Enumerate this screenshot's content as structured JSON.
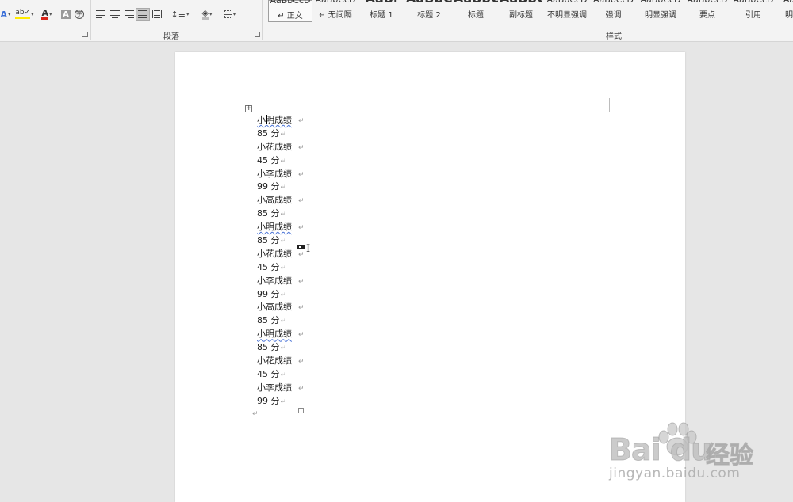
{
  "ribbon": {
    "font_group_buttons": [
      "A",
      "ab✓",
      "A",
      "A",
      "字"
    ],
    "paragraph_label": "段落",
    "styles_label": "样式",
    "styles": [
      {
        "preview": "AaBbCcD",
        "name": "↵ 正文"
      },
      {
        "preview": "AaBbCcD",
        "name": "↵ 无间隔"
      },
      {
        "preview": "AaBl",
        "name": "标题 1"
      },
      {
        "preview": "AaBbC",
        "name": "标题 2"
      },
      {
        "preview": "AaBbC",
        "name": "标题"
      },
      {
        "preview": "AaBbC",
        "name": "副标题"
      },
      {
        "preview": "AaBbCcD",
        "name": "不明显强调"
      },
      {
        "preview": "AaBbCcD",
        "name": "强调"
      },
      {
        "preview": "AaBbCcD",
        "name": "明显强调"
      },
      {
        "preview": "AaBbCcD",
        "name": "要点"
      },
      {
        "preview": "AaBbCcD",
        "name": "引用"
      },
      {
        "preview": "Aa",
        "name": "明"
      }
    ]
  },
  "document": {
    "lines": [
      {
        "text": "小明成绩",
        "kind": "name",
        "mark": "↵"
      },
      {
        "text": "85 分",
        "kind": "score",
        "mark": "↵"
      },
      {
        "text": "小花成绩",
        "kind": "name",
        "mark": "↵"
      },
      {
        "text": "45 分",
        "kind": "score",
        "mark": "↵"
      },
      {
        "text": "小李成绩",
        "kind": "name",
        "mark": "↵"
      },
      {
        "text": "99 分",
        "kind": "score",
        "mark": "↵"
      },
      {
        "text": "小高成绩",
        "kind": "name",
        "mark": "↵"
      },
      {
        "text": "85 分",
        "kind": "score",
        "mark": "↵"
      },
      {
        "text": "小明成绩",
        "kind": "name",
        "mark": "↵"
      },
      {
        "text": "85 分",
        "kind": "score",
        "mark": "↵"
      },
      {
        "text": "小花成绩",
        "kind": "name",
        "mark": "↵"
      },
      {
        "text": "45 分",
        "kind": "score",
        "mark": "↵"
      },
      {
        "text": "小李成绩",
        "kind": "name",
        "mark": "↵"
      },
      {
        "text": "99 分",
        "kind": "score",
        "mark": "↵"
      },
      {
        "text": "小高成绩",
        "kind": "name",
        "mark": "↵"
      },
      {
        "text": "85 分",
        "kind": "score",
        "mark": "↵"
      },
      {
        "text": "小明成绩",
        "kind": "name",
        "mark": "↵"
      },
      {
        "text": "85 分",
        "kind": "score",
        "mark": "↵"
      },
      {
        "text": "小花成绩",
        "kind": "name",
        "mark": "↵"
      },
      {
        "text": "45 分",
        "kind": "score",
        "mark": "↵"
      },
      {
        "text": "小李成绩",
        "kind": "name",
        "mark": "↵"
      },
      {
        "text": "99 分",
        "kind": "score",
        "mark": "↵"
      }
    ],
    "end_mark": "↵"
  },
  "watermark": {
    "brand": "Bai du",
    "cn": "经验",
    "url": "jingyan.baidu.com"
  },
  "colors": {
    "ribbon_bg": "#f3f3f3",
    "canvas_bg": "#e6e6e6",
    "page_bg": "#ffffff",
    "spell_squiggle": "#4a73d6",
    "highlight_yellow": "#ffeb00",
    "font_red": "#d9261c"
  }
}
